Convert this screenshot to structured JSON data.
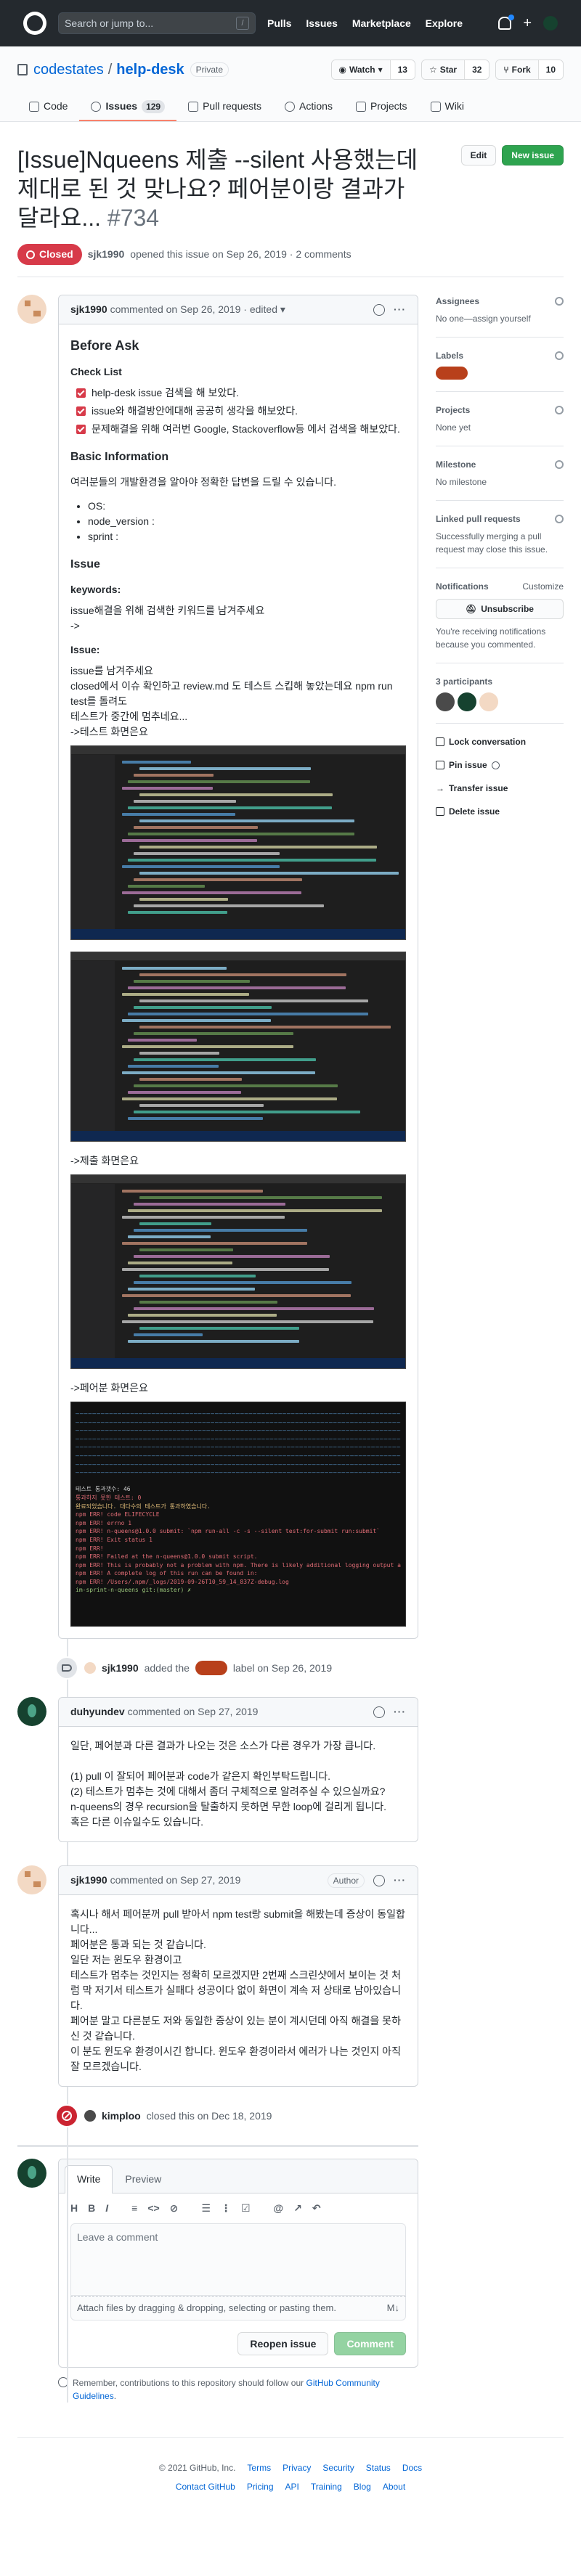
{
  "header": {
    "search_placeholder": "Search or jump to...",
    "slash_key": "/",
    "nav": [
      "Pulls",
      "Issues",
      "Marketplace",
      "Explore"
    ],
    "plus": "+"
  },
  "repo": {
    "owner": "codestates",
    "separator": "/",
    "name": "help-desk",
    "visibility": "Private",
    "watch_label": "Watch",
    "watch_count": "13",
    "star_label": "Star",
    "star_count": "32",
    "fork_label": "Fork",
    "fork_count": "10",
    "tabs": [
      {
        "label": "Code",
        "icon": "code-icon"
      },
      {
        "label": "Issues",
        "icon": "issue-opened-icon",
        "count": "129"
      },
      {
        "label": "Pull requests",
        "icon": "git-pull-request-icon"
      },
      {
        "label": "Actions",
        "icon": "play-icon"
      },
      {
        "label": "Projects",
        "icon": "project-icon"
      },
      {
        "label": "Wiki",
        "icon": "book-icon"
      }
    ]
  },
  "issue": {
    "title": "[Issue]Nqueens 제출 --silent 사용했는데 제대로 된 것 맞나요? 페어분이랑 결과가 달라요...",
    "number": "#734",
    "edit_label": "Edit",
    "new_issue_label": "New issue",
    "state": "Closed",
    "author": "sjk1990",
    "opened_text": "opened this issue on Sep 26, 2019 · 2 comments"
  },
  "comments": [
    {
      "author": "sjk1990",
      "meta": "commented on Sep 26, 2019 · edited",
      "body": {
        "h_before": "Before Ask",
        "h_checklist": "Check List",
        "checks": [
          "help-desk issue 검색을 해 보았다.",
          "issue와 해결방안에대해 공공히 생각을 해보았다.",
          "문제해결을 위해 여러번 Google, Stackoverflow등 에서 검색을 해보았다."
        ],
        "h_basic": "Basic Information",
        "basic_desc": "여러분들의 개발환경을 알아야 정확한 답변을 드릴 수 있습니다.",
        "env": [
          "OS:",
          "node_version :",
          "sprint :"
        ],
        "h_issue": "Issue",
        "h_keywords": "keywords:",
        "keywords_desc": "issue해결을 위해 검색한 키워드를 남겨주세요",
        "keywords_arrow": "->",
        "h_issue2": "Issue:",
        "issue_lines": [
          "issue를 남겨주세요",
          "closed에서 이슈 확인하고 review.md 도 테스트 스킵해 놓았는데요 npm run test를 돌려도",
          "테스트가 중간에 멈추네요...",
          "->테스트 화면은요"
        ],
        "submit_caption": "->제출 화면은요",
        "pair_caption": "->페어분 화면은요",
        "terminal": {
          "lines": [
            "테스트 통과갯수: 46",
            "통과하지 못한 테스트: 0",
            "완료되었습니다. 대다수의 테스트가 통과하였습니다.",
            "npm ERR! code ELIFECYCLE",
            "npm ERR! errno 1",
            "npm ERR! n-queens@1.0.0 submit: `npm run-all -c -s --silent test:for-submit run:submit`",
            "npm ERR! Exit status 1",
            "npm ERR!",
            "npm ERR! Failed at the n-queens@1.0.0 submit script.",
            "npm ERR! This is probably not a problem with npm. There is likely additional logging output above.",
            "",
            "npm ERR! A complete log of this run can be found in:",
            "npm ERR!     /Users/.npm/_logs/2019-09-26T10_59_14_837Z-debug.log",
            "im-sprint-n-queens git:(master) ✗"
          ]
        }
      }
    },
    {
      "author": "duhyundev",
      "meta": "commented on Sep 27, 2019",
      "lines": [
        "일단, 페어분과 다른 결과가 나오는 것은 소스가 다른 경우가 가장 큽니다.",
        "",
        "(1) pull 이 잘되어 페어분과 code가 같은지 확인부탁드립니다.",
        "(2) 테스트가 멈추는 것에 대해서 좀더 구체적으로 알려주실 수 있으실까요?",
        "n-queens의 경우 recursion을 탈출하지 못하면 무한 loop에 걸리게 됩니다.",
        "혹은 다른 이슈일수도 있습니다."
      ]
    },
    {
      "author": "sjk1990",
      "meta": "commented on Sep 27, 2019",
      "badge": "Author",
      "lines": [
        "혹시나 해서 페어분꺼 pull 받아서 npm test랑 submit을 해봤는데 증상이 동일합니다...",
        "페어분은 통과 되는 것 같습니다.",
        "일단 저는 윈도우 환경이고",
        "테스트가 멈추는 것인지는 정확히 모르겠지만 2번째 스크린샷에서 보이는 것 처럼 막 저기서 테스트가 실패다 성공이다 없이 화면이 계속 저 상태로 남아있습니다.",
        "페어분 말고 다른분도 저와 동일한 증상이 있는 분이 계시던데 아직 해결을 못하신 것 같습니다.",
        "이 분도 윈도우 환경이시긴 합니다. 윈도우 환경이라서 에러가 나는 것인지 아직 잘 모르겠습니다."
      ]
    }
  ],
  "events": {
    "labeled": {
      "actor": "sjk1990",
      "pre": "added the",
      "post": "label on Sep 26, 2019"
    },
    "closed": {
      "actor": "kimploo",
      "text": "closed this on Dec 18, 2019"
    }
  },
  "editor": {
    "tab_write": "Write",
    "tab_preview": "Preview",
    "toolbar": [
      "H",
      "B",
      "I",
      "≡",
      "<>",
      "⊘",
      "☰",
      "⋮",
      "☑",
      "@",
      "↗",
      "↶"
    ],
    "placeholder": "Leave a comment",
    "attach_text": "Attach files by dragging & dropping, selecting or pasting them.",
    "md_icon": "M↓",
    "reopen_label": "Reopen issue",
    "comment_label": "Comment",
    "reminder_pre": "Remember, contributions to this repository should follow our",
    "reminder_link": "GitHub Community Guidelines",
    "reminder_post": "."
  },
  "sidebar": {
    "assignees_title": "Assignees",
    "assignees_value": "No one—assign yourself",
    "labels_title": "Labels",
    "label_color": "#b8401b",
    "projects_title": "Projects",
    "projects_value": "None yet",
    "milestone_title": "Milestone",
    "milestone_value": "No milestone",
    "linked_title": "Linked pull requests",
    "linked_value": "Successfully merging a pull request may close this issue.",
    "notifications_title": "Notifications",
    "customize": "Customize",
    "unsubscribe": "Unsubscribe",
    "notif_reason": "You're receiving notifications because you commented.",
    "participants": "3 participants",
    "lock": "Lock conversation",
    "pin": "Pin issue",
    "transfer": "Transfer issue",
    "delete": "Delete issue"
  },
  "footer": {
    "copyright": "© 2021 GitHub, Inc.",
    "row1": [
      "Terms",
      "Privacy",
      "Security",
      "Status",
      "Docs"
    ],
    "row2": [
      "Contact GitHub",
      "Pricing",
      "API",
      "Training",
      "Blog",
      "About"
    ]
  }
}
